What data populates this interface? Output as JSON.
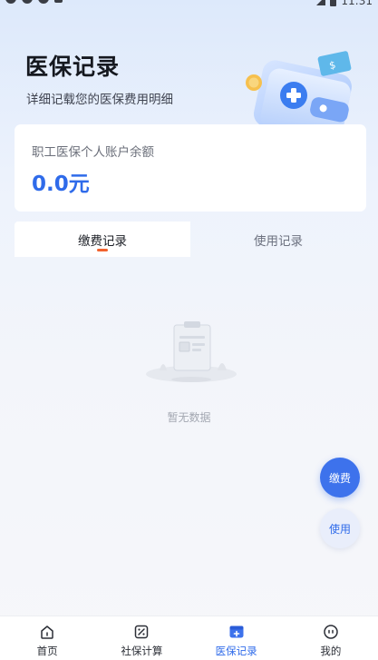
{
  "status_bar": {
    "time": "11:31"
  },
  "header": {
    "title": "医保记录",
    "subtitle": "详细记载您的医保费用明细"
  },
  "balance": {
    "label": "职工医保个人账户余额",
    "value": "0.0元"
  },
  "tabs": [
    {
      "label": "缴费记录",
      "active": true
    },
    {
      "label": "使用记录",
      "active": false
    }
  ],
  "empty_state": {
    "text": "暂无数据"
  },
  "fab": {
    "pay_label": "缴费",
    "use_label": "使用"
  },
  "bottom_nav": [
    {
      "label": "首页",
      "icon": "home-icon",
      "active": false
    },
    {
      "label": "社保计算",
      "icon": "calculator-icon",
      "active": false
    },
    {
      "label": "医保记录",
      "icon": "medical-record-icon",
      "active": true
    },
    {
      "label": "我的",
      "icon": "profile-icon",
      "active": false
    }
  ],
  "colors": {
    "accent": "#2f6bea",
    "tab_indicator": "#f2622e",
    "fab_primary": "#3d72ec"
  }
}
